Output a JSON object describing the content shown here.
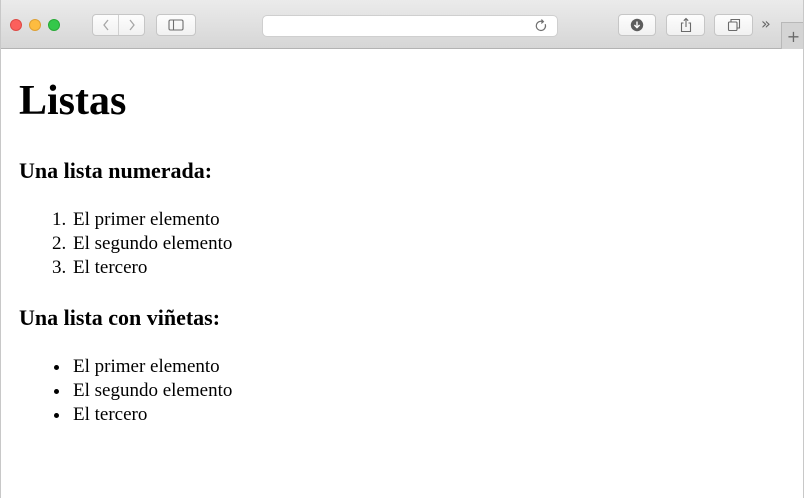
{
  "browser": {
    "url": "",
    "icons": {
      "back": "chevron-left-icon",
      "forward": "chevron-right-icon",
      "sidebar": "sidebar-icon",
      "reload": "reload-icon",
      "downloads": "download-icon",
      "share": "share-icon",
      "tabs": "tabs-overview-icon",
      "overflow": "chevron-double-right-icon",
      "new_tab": "plus-icon"
    }
  },
  "page": {
    "title": "Listas",
    "numbered_heading": "Una lista numerada:",
    "numbered_items": [
      "El primer elemento",
      "El segundo elemento",
      "El tercero"
    ],
    "bulleted_heading": "Una lista con viñetas:",
    "bulleted_items": [
      "El primer elemento",
      "El segundo elemento",
      "El tercero"
    ]
  }
}
